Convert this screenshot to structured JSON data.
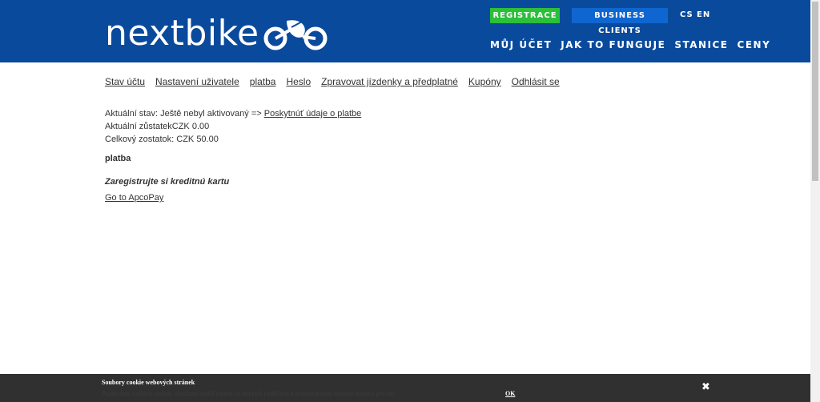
{
  "header": {
    "logo_text": "nextbike",
    "registrace_label": "REGISTRACE",
    "business_label": "BUSINESS CLIENTS",
    "lang_cs": "CS",
    "lang_en": "EN",
    "nav": [
      "MŮJ ÚČET",
      "JAK TO FUNGUJE",
      "STANICE",
      "CENY"
    ],
    "colors": {
      "header_bg": "#0a4a9c",
      "registrace_bg": "#2bbf3a",
      "business_bg": "#0f66d1"
    }
  },
  "subnav": [
    "Stav účtu",
    "Nastavení uživatele",
    "platba",
    "Heslo",
    "Zpravovat jízdenky a předplatné",
    "Kupóny",
    "Odhlásit se"
  ],
  "account": {
    "status_prefix": "Aktuální stav: Ještě nebyl aktivovaný => ",
    "status_link": "Poskytnúť údaje o platbe",
    "balance": "Aktuální zůstatekCZK 0.00",
    "total": "Celkový zostatok: CZK 50.00",
    "payment_heading": "platba",
    "card_heading": "Zaregistrujte si kreditnú kartu",
    "apcopay_link": "Go to ApcoPay"
  },
  "cookie": {
    "title": "Soubory cookie webových stránek",
    "text": "Používáme soubory cookie, abychom mohli zajistit co nejlepší funkčnost a zlepšovat naše webové stránky pro vás.",
    "ok_label": "OK",
    "close_icon": "close-icon"
  }
}
